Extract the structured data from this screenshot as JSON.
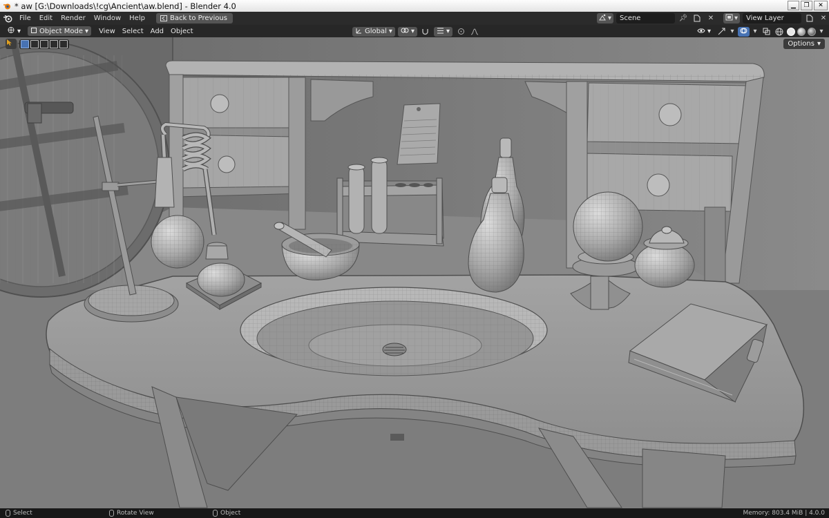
{
  "window": {
    "title": "* aw [G:\\Downloads\\!cg\\Ancient\\aw.blend] - Blender 4.0",
    "minimize": "▁",
    "maximize": "❐",
    "close": "✕"
  },
  "topbar": {
    "menus": [
      "File",
      "Edit",
      "Render",
      "Window",
      "Help"
    ],
    "back_button": "Back to Previous",
    "scene": "Scene",
    "view_layer": "View Layer"
  },
  "viewport_header": {
    "mode": "Object Mode",
    "menus": [
      "View",
      "Select",
      "Add",
      "Object"
    ],
    "transform_orientation": "Global",
    "options": "Options"
  },
  "statusbar": {
    "select": "Select",
    "rotate": "Rotate View",
    "object": "Object",
    "memory": "Memory: 803.4 MiB | 4.0.0"
  },
  "colors": {
    "accent": "#4772b3",
    "header_bg": "#2b2b2b",
    "viewport_bg": "#737373"
  }
}
